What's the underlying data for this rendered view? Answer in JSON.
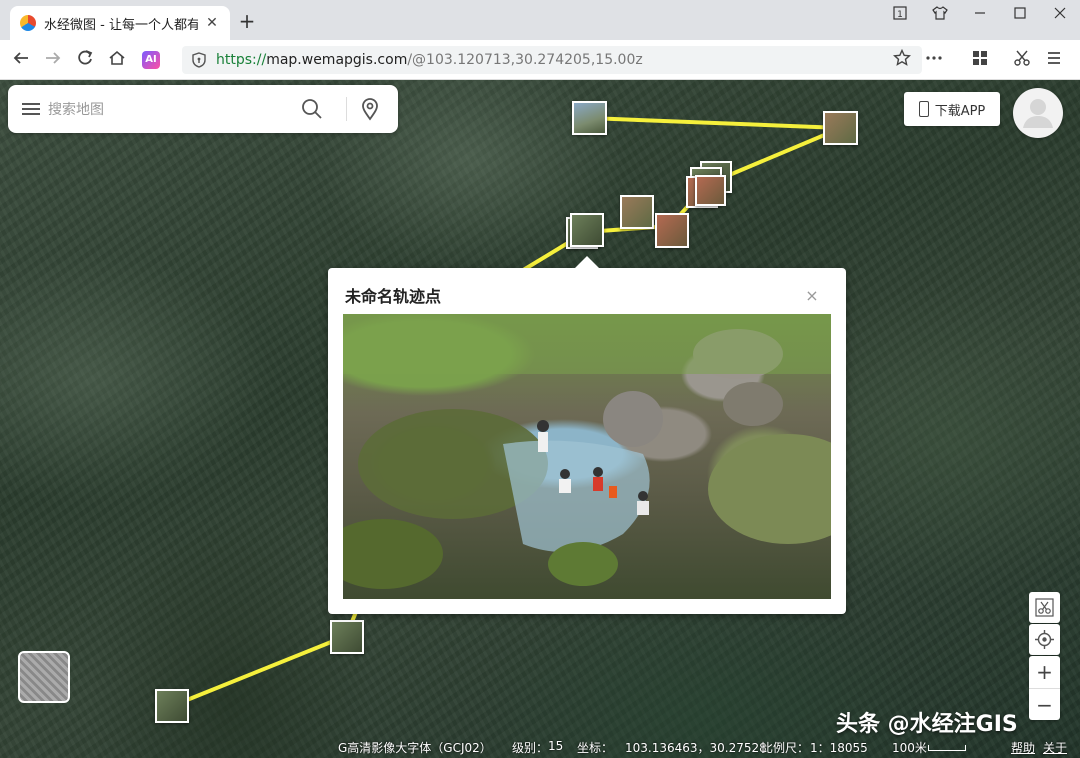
{
  "browser": {
    "tab_title": "水经微图 - 让每一个人都有自",
    "tab_close": "✕",
    "new_tab": "+",
    "url_scheme": "https://",
    "url_host": "map.wemapgis.com",
    "url_path": "/@103.120713,30.274205,15.00z",
    "ai_label": "AI"
  },
  "search": {
    "placeholder": "搜索地图"
  },
  "download_app": "下载APP",
  "popup": {
    "title": "未命名轨迹点",
    "close": "×"
  },
  "zoom": {
    "in": "+",
    "out": "−"
  },
  "status": {
    "layer": "G高清影像大字体（GCJ02）",
    "level_label": "级别：",
    "level": "15",
    "coord_label": "坐标：",
    "coord": "103.136463，30.27528",
    "scale_label": "比例尺：",
    "scale": "1：18055",
    "scale_bar": "100米",
    "help": "帮助",
    "about": "关于"
  },
  "watermark": "头条 @水经注GIS",
  "colors": {
    "track": "#f5f03c",
    "url_scheme": "#188038"
  }
}
